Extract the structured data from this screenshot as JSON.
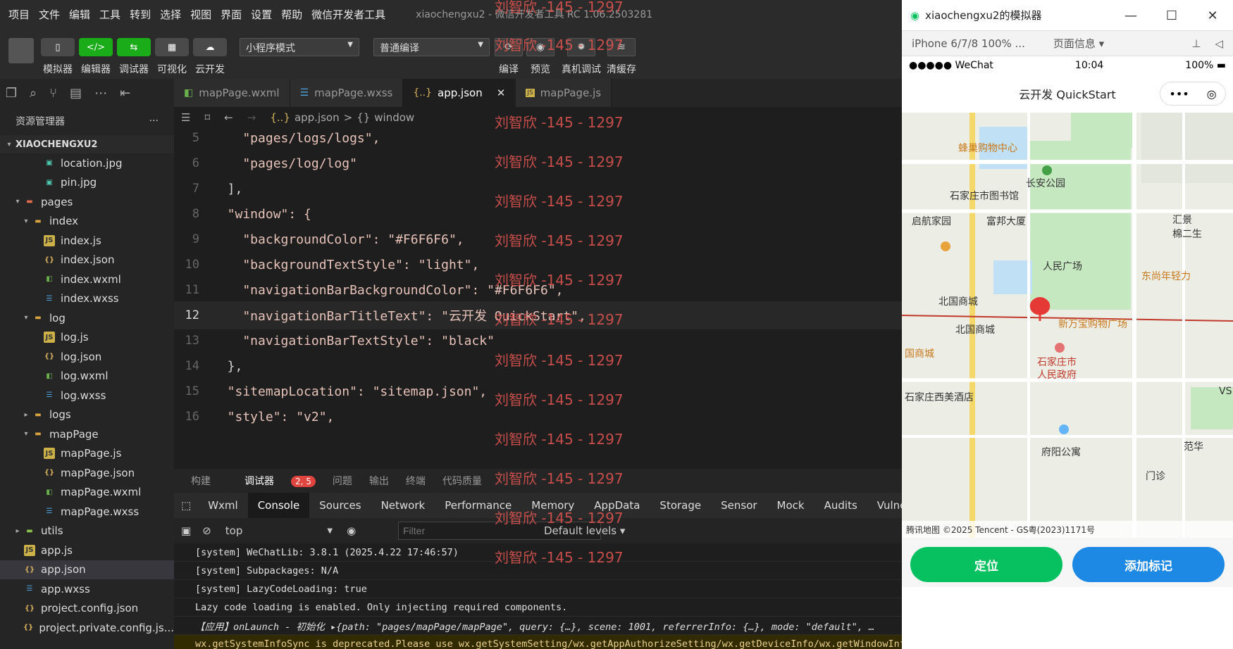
{
  "menubar": {
    "items": [
      "项目",
      "文件",
      "编辑",
      "工具",
      "转到",
      "选择",
      "视图",
      "界面",
      "设置",
      "帮助",
      "微信开发者工具"
    ],
    "title": "xiaochengxu2 - 微信开发者工具 RC 1.06.2503281"
  },
  "toolbar": {
    "simulator": "模拟器",
    "editor": "编辑器",
    "debugger": "调试器",
    "visual": "可视化",
    "cloud": "云开发",
    "mode": "小程序模式",
    "compile_mode": "普通编译",
    "compile": "编译",
    "preview": "预览",
    "real_debug": "真机调试",
    "clear_cache": "清缓存"
  },
  "watermark": "刘智欣 -145 - 1297",
  "explorer": {
    "title": "资源管理器",
    "more": "···",
    "project": "XIAOCHENGXU2",
    "items": [
      {
        "label": "location.jpg",
        "type": "img",
        "depth": 3
      },
      {
        "label": "pin.jpg",
        "type": "img",
        "depth": 3
      },
      {
        "label": "pages",
        "type": "pages",
        "depth": 1,
        "arrow": "▾"
      },
      {
        "label": "index",
        "type": "folder",
        "depth": 2,
        "arrow": "▾"
      },
      {
        "label": "index.js",
        "type": "js",
        "depth": 3
      },
      {
        "label": "index.json",
        "type": "json",
        "depth": 3
      },
      {
        "label": "index.wxml",
        "type": "wxml",
        "depth": 3
      },
      {
        "label": "index.wxss",
        "type": "wxss",
        "depth": 3
      },
      {
        "label": "log",
        "type": "folder",
        "depth": 2,
        "arrow": "▾"
      },
      {
        "label": "log.js",
        "type": "js",
        "depth": 3
      },
      {
        "label": "log.json",
        "type": "json",
        "depth": 3
      },
      {
        "label": "log.wxml",
        "type": "wxml",
        "depth": 3
      },
      {
        "label": "log.wxss",
        "type": "wxss",
        "depth": 3
      },
      {
        "label": "logs",
        "type": "folder",
        "depth": 2,
        "arrow": "▸"
      },
      {
        "label": "mapPage",
        "type": "folder",
        "depth": 2,
        "arrow": "▾"
      },
      {
        "label": "mapPage.js",
        "type": "js",
        "depth": 3
      },
      {
        "label": "mapPage.json",
        "type": "json",
        "depth": 3
      },
      {
        "label": "mapPage.wxml",
        "type": "wxml",
        "depth": 3
      },
      {
        "label": "mapPage.wxss",
        "type": "wxss",
        "depth": 3
      },
      {
        "label": "utils",
        "type": "utils",
        "depth": 1,
        "arrow": "▸"
      },
      {
        "label": "app.js",
        "type": "js",
        "depth": 1
      },
      {
        "label": "app.json",
        "type": "json",
        "depth": 1,
        "selected": true
      },
      {
        "label": "app.wxss",
        "type": "wxss",
        "depth": 1
      },
      {
        "label": "project.config.json",
        "type": "json",
        "depth": 1
      },
      {
        "label": "project.private.config.js...",
        "type": "json",
        "depth": 1
      }
    ]
  },
  "tabs": [
    {
      "label": "mapPage.wxml",
      "icon": "wxml"
    },
    {
      "label": "mapPage.wxss",
      "icon": "wxss"
    },
    {
      "label": "app.json",
      "icon": "json",
      "active": true
    },
    {
      "label": "mapPage.js",
      "icon": "js"
    }
  ],
  "breadcrumb": {
    "file": "app.json",
    "sep": ">",
    "node": "window"
  },
  "code": [
    {
      "ln": "5",
      "text": "    \"pages/logs/logs\","
    },
    {
      "ln": "6",
      "text": "    \"pages/log/log\""
    },
    {
      "ln": "7",
      "text": "  ],"
    },
    {
      "ln": "8",
      "text": "  \"window\": {"
    },
    {
      "ln": "9",
      "text": "    \"backgroundColor\": \"#F6F6F6\","
    },
    {
      "ln": "10",
      "text": "    \"backgroundTextStyle\": \"light\","
    },
    {
      "ln": "11",
      "text": "    \"navigationBarBackgroundColor\": \"#F6F6F6\","
    },
    {
      "ln": "12",
      "text": "    \"navigationBarTitleText\": \"云开发 QuickStart\",",
      "current": true
    },
    {
      "ln": "13",
      "text": "    \"navigationBarTextStyle\": \"black\""
    },
    {
      "ln": "14",
      "text": "  },"
    },
    {
      "ln": "15",
      "text": "  \"sitemapLocation\": \"sitemap.json\","
    },
    {
      "ln": "16",
      "text": "  \"style\": \"v2\","
    }
  ],
  "panel_tabs": {
    "build": "构建",
    "debugger": "调试器",
    "badge": "2, 5",
    "problems": "问题",
    "output": "输出",
    "terminal": "终端",
    "quality": "代码质量"
  },
  "devtools_tabs": [
    "Wxml",
    "Console",
    "Sources",
    "Network",
    "Performance",
    "Memory",
    "AppData",
    "Storage",
    "Sensor",
    "Mock",
    "Audits",
    "Vulnerabili"
  ],
  "filter": {
    "context": "top",
    "placeholder": "Filter",
    "levels": "Default levels ▾"
  },
  "console": [
    "[system] WeChatLib: 3.8.1 (2025.4.22 17:46:57)",
    "[system] Subpackages: N/A",
    "[system] LazyCodeLoading: true",
    "Lazy code loading is enabled. Only injecting required components.",
    "【应用】onLaunch - 初始化 ▸{path: \"pages/mapPage/mapPage\", query: {…}, scene: 1001, referrerInfo: {…}, mode: \"default\", …",
    "wx.getSystemInfoSync is deprecated.Please use wx.getSystemSetting/wx.getAppAuthorizeSetting/wx.getDeviceInfo/wx.getWindowInfo/wx.getAppBaseInfo"
  ],
  "simulator": {
    "window_title": "xiaochengxu2的模拟器",
    "device": "iPhone 6/7/8 100% ...",
    "page_info": "页面信息 ▾",
    "carrier": "●●●●● WeChat",
    "time": "10:04",
    "battery": "100%",
    "nav_title": "云开发 QuickStart",
    "map_labels": [
      "蜂巢购物中心",
      "长安公园",
      "石家庄市图书馆",
      "启航家园",
      "富邦大厦",
      "汇景",
      "棉二生",
      "人民广场",
      "东尚年轻力",
      "北国商城",
      "北国商城",
      "新万宝购物广场",
      "国商城",
      "石家庄市",
      "人民政府",
      "石家庄西美酒店",
      "府阳公寓",
      "范华",
      "门诊",
      "VS"
    ],
    "map_copyright": "腾讯地图  ©2025 Tencent - GS粤(2023)1171号",
    "btn_locate": "定位",
    "btn_mark": "添加标记"
  },
  "colors": {
    "accent_green": "#07c160",
    "accent_blue": "#1e88e5",
    "watermark": "#d9534f"
  }
}
